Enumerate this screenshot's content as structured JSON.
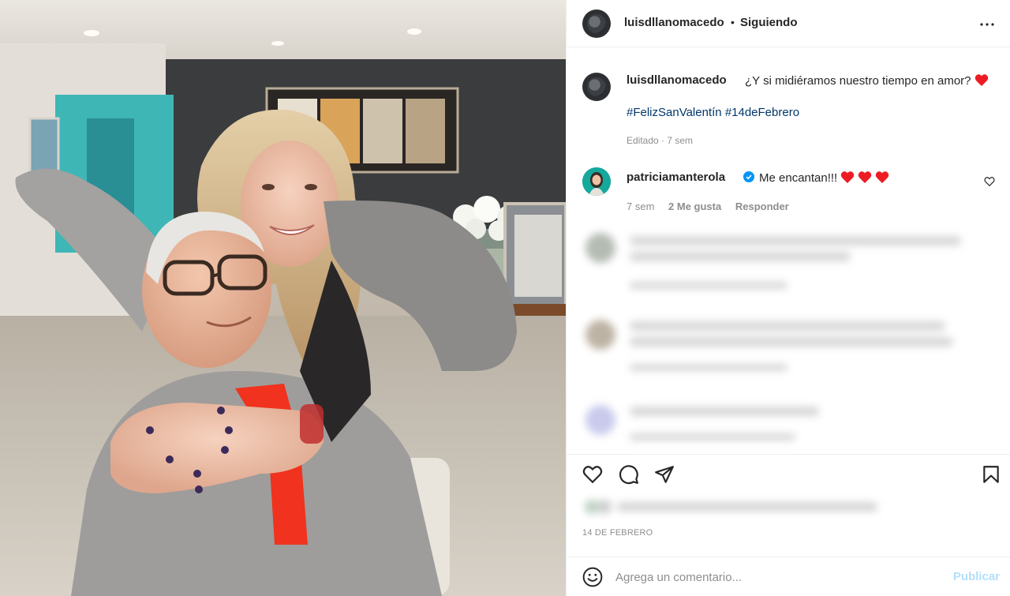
{
  "post": {
    "username": "luisdllanomacedo",
    "separator": "•",
    "follow_state": "Siguiendo",
    "more_icon": "more-horizontal-icon"
  },
  "caption": {
    "username": "luisdllanomacedo",
    "text": "¿Y si midiéramos nuestro tiempo en amor?",
    "hashtags": [
      "#FelizSanValentín",
      "#14deFebrero"
    ],
    "meta": "Editado · 7 sem",
    "heart_emoji": "red-heart-emoji"
  },
  "comment": {
    "username": "patriciamanterola",
    "verified_icon": "verified-badge-icon",
    "text": "Me encantan!!!",
    "time": "7 sem",
    "likes": "2 Me gusta",
    "reply": "Responder"
  },
  "actions": {
    "like_icon": "heart-icon",
    "comment_icon": "comment-bubble-icon",
    "share_icon": "paper-plane-icon",
    "save_icon": "bookmark-icon"
  },
  "date": "14 DE FEBRERO",
  "composer": {
    "placeholder": "Agrega un comentario...",
    "publish": "Publicar",
    "emoji_icon": "smiley-icon"
  },
  "colors": {
    "hashtag": "#00376b",
    "muted": "#8e8e8e",
    "verified": "#0095f6",
    "publish_disabled": "#b2dffc",
    "heart": "#ed1c24"
  }
}
